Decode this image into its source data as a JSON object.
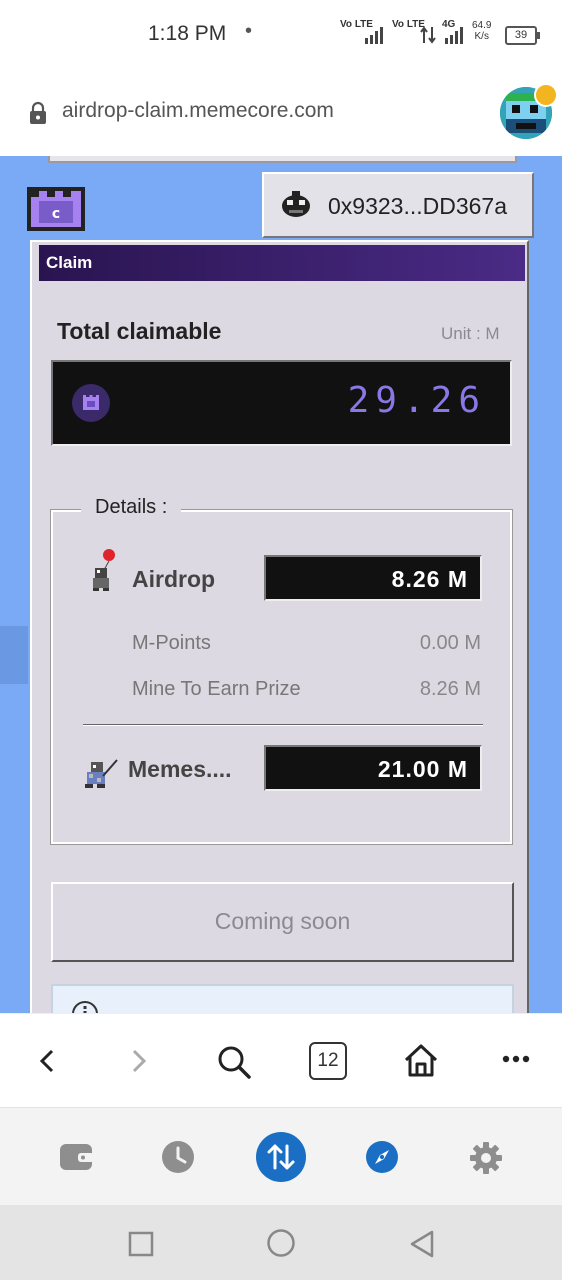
{
  "status_bar": {
    "time": "1:18 PM",
    "dot": "•",
    "signal1": "Vo LTE",
    "signal2": "Vo LTE",
    "net": "4G",
    "speed_value": "64.9",
    "speed_unit": "K/s",
    "battery": "39"
  },
  "browser": {
    "url": "airdrop-claim.memecore.com",
    "tab_count": "12"
  },
  "wallet": {
    "address": "0x9323...DD367a"
  },
  "claim": {
    "window_title": "Claim",
    "total_label": "Total claimable",
    "unit_label": "Unit : M",
    "total_value": "29.26",
    "details_legend": "Details :",
    "airdrop": {
      "label": "Airdrop",
      "value": "8.26  M",
      "sub_items": [
        {
          "label": "M-Points",
          "value": "0.00 M"
        },
        {
          "label": "Mine To Earn Prize",
          "value": "8.26 M"
        }
      ]
    },
    "memes": {
      "label": "Memes....",
      "value": "21.00  M"
    },
    "action_button": "Coming soon"
  },
  "icons": {
    "lock": "lock-icon",
    "back": "chevron-left-icon",
    "forward": "chevron-right-icon",
    "search": "search-icon",
    "home": "home-icon",
    "more": "more-dots-icon",
    "wallet": "wallet-icon",
    "history": "clock-icon",
    "transfer": "transfer-arrows-icon",
    "explore": "compass-icon",
    "settings": "gear-icon"
  },
  "colors": {
    "page_bg": "#7aa9f5",
    "window_bg": "#ddd9e2",
    "title_bar": "#2a1450",
    "digit_color": "#8a78e6",
    "accent_blue": "#1a6fc4"
  }
}
